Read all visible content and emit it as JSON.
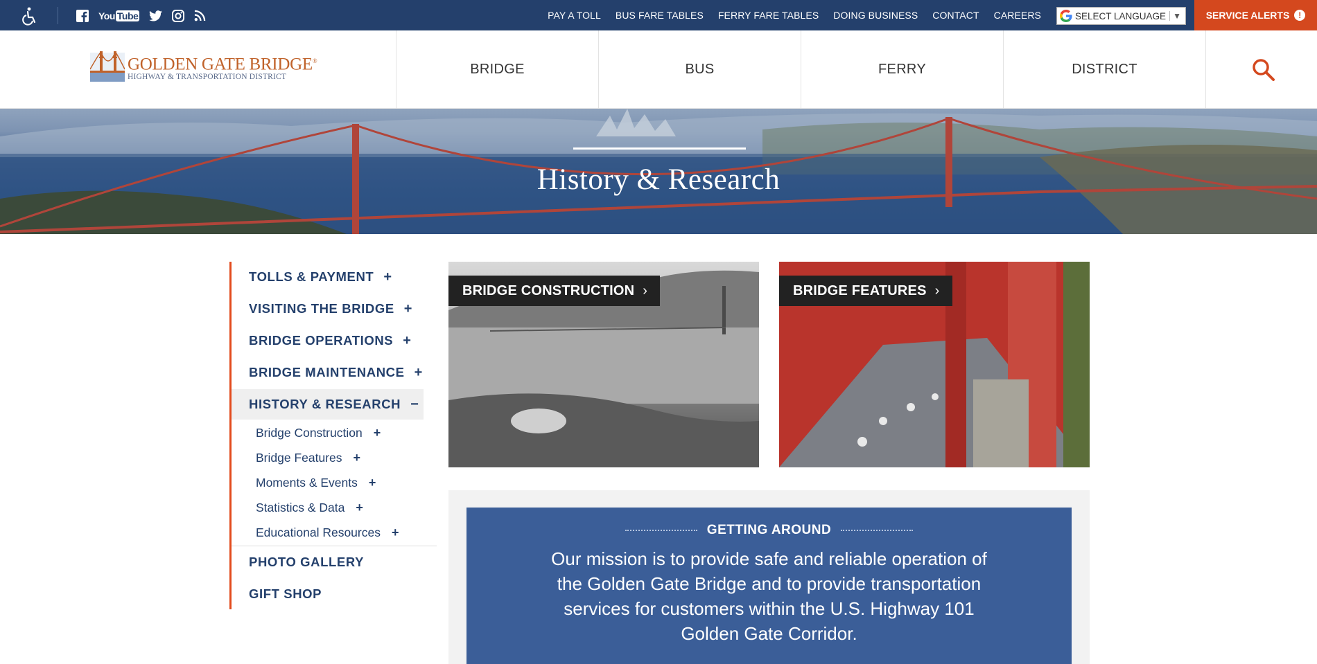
{
  "colors": {
    "navy": "#24406c",
    "accent": "#d4481e",
    "mission_bg": "#3b5e98"
  },
  "utility_nav": {
    "links": [
      "PAY A TOLL",
      "BUS FARE TABLES",
      "FERRY FARE TABLES",
      "DOING BUSINESS",
      "CONTACT",
      "CAREERS"
    ],
    "language_label": "SELECT LANGUAGE",
    "service_alerts": "SERVICE ALERTS",
    "social_icons": [
      "facebook-icon",
      "youtube-icon",
      "twitter-icon",
      "instagram-icon",
      "rss-icon"
    ],
    "youtube_you": "You",
    "youtube_tube": "Tube"
  },
  "logo": {
    "line1": "GOLDEN GATE BRIDGE",
    "line2": "HIGHWAY & TRANSPORTATION DISTRICT"
  },
  "main_nav": [
    "BRIDGE",
    "BUS",
    "FERRY",
    "DISTRICT"
  ],
  "hero": {
    "title": "History & Research"
  },
  "sidenav": {
    "items": [
      {
        "label": "TOLLS & PAYMENT",
        "toggle": "+"
      },
      {
        "label": "VISITING THE BRIDGE",
        "toggle": "+"
      },
      {
        "label": "BRIDGE OPERATIONS",
        "toggle": "+"
      },
      {
        "label": "BRIDGE MAINTENANCE",
        "toggle": "+"
      },
      {
        "label": "HISTORY & RESEARCH",
        "toggle": "−"
      }
    ],
    "subitems": [
      {
        "label": "Bridge Construction",
        "toggle": "+"
      },
      {
        "label": "Bridge Features",
        "toggle": "+"
      },
      {
        "label": "Moments & Events",
        "toggle": "+"
      },
      {
        "label": "Statistics & Data",
        "toggle": "+"
      },
      {
        "label": "Educational Resources",
        "toggle": "+"
      }
    ],
    "bottom_items": [
      "PHOTO GALLERY",
      "GIFT SHOP"
    ]
  },
  "cards": [
    {
      "label": "BRIDGE CONSTRUCTION",
      "chevron": "›"
    },
    {
      "label": "BRIDGE FEATURES",
      "chevron": "›"
    }
  ],
  "mission": {
    "kicker": "GETTING AROUND",
    "text": "Our mission is to provide safe and reliable operation of the Golden Gate Bridge and to provide transportation services for customers within the U.S. Highway 101 Golden Gate Corridor."
  }
}
